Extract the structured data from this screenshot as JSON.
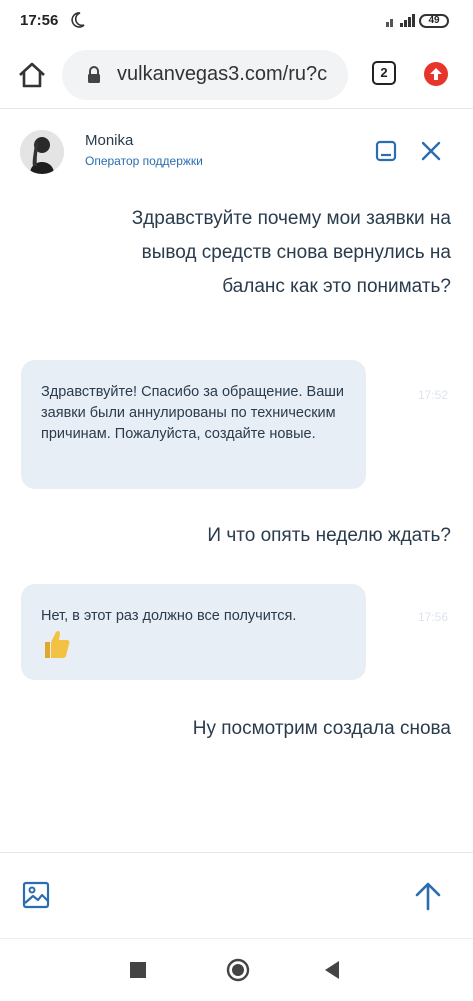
{
  "status_bar": {
    "time": "17:56",
    "battery": "49"
  },
  "browser": {
    "url": "vulkanvegas3.com/ru?c",
    "tab_count": "2"
  },
  "chat": {
    "agent_name": "Monika",
    "agent_role": "Оператор поддержки",
    "messages": [
      {
        "from": "user",
        "text": "Здравствуйте почему мои заявки на вывод средств снова вернулись на баланс как это понимать?"
      },
      {
        "from": "agent",
        "text": "Здравствуйте! Спасибо за обращение. Ваши заявки были аннулированы по техническим причинам. Пожалуйста, создайте новые.",
        "time": "17:52"
      },
      {
        "from": "user",
        "text": "И что опять неделю ждать?"
      },
      {
        "from": "agent",
        "text": "Нет, в этот раз должно все получится.",
        "time": "17:56",
        "emoji": "thumbs-up"
      },
      {
        "from": "user",
        "text": "Ну посмотрим создала снова"
      }
    ]
  },
  "colors": {
    "accent": "#2a6db0",
    "bubble": "#e8eef6",
    "text": "#2a3b4c",
    "update_badge": "#e7352b"
  }
}
